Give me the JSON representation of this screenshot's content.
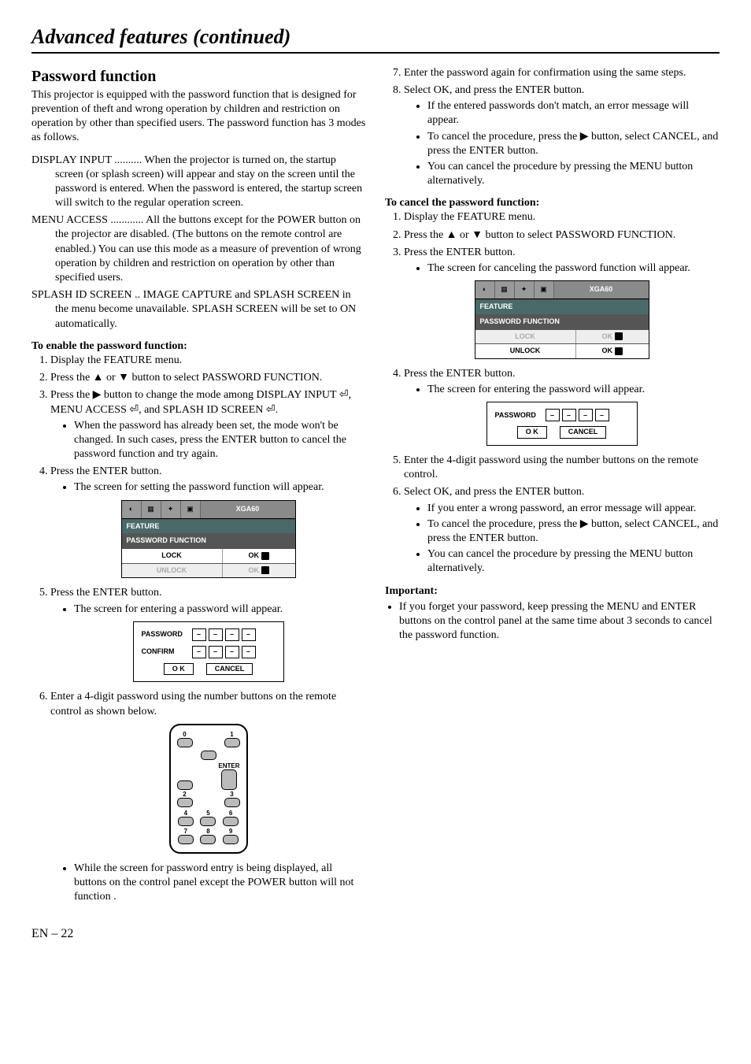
{
  "page_title": "Advanced features (continued)",
  "page_number": "EN – 22",
  "left": {
    "section_title": "Password function",
    "intro": "This projector is equipped with the password function that is designed for prevention of theft and wrong operation by children and restriction on operation by other than specified users. The password function has 3 modes as follows.",
    "modes": [
      "DISPLAY INPUT .......... When the projector is turned on, the startup screen (or splash screen) will appear and stay on the screen until the password is entered. When the password is entered, the startup screen will switch to the regular operation screen.",
      "MENU ACCESS ............ All the buttons except for the POWER button on the projector are disabled. (The buttons on the remote control are enabled.) You can use this mode as a measure of prevention of wrong operation by children and restriction on operation by other than specified users.",
      "SPLASH ID SCREEN .. IMAGE CAPTURE and SPLASH SCREEN in the menu become unavailable. SPLASH SCREEN will be set to ON automatically."
    ],
    "enable_head": "To enable the password function:",
    "steps_a": [
      "Display the FEATURE menu.",
      "Press the ▲ or ▼ button to select PASSWORD FUNCTION.",
      "Press the ▶ button to change the mode among DISPLAY INPUT ⏎, MENU ACCESS ⏎, and SPLASH ID SCREEN ⏎."
    ],
    "step3_bullet": "When the password has already been set, the mode won't be changed. In such cases, press the ENTER button to cancel the password function and try again.",
    "step4": "Press the ENTER button.",
    "step4_bullet": "The screen for setting the password function will appear.",
    "menu1": {
      "res": "XGA60",
      "feature": "FEATURE",
      "pwfunc": "PASSWORD FUNCTION",
      "lock": "LOCK",
      "unlock": "UNLOCK",
      "ok": "OK"
    },
    "step5": "Press the ENTER button.",
    "step5_bullet": "The screen for entering a password will appear.",
    "pw1": {
      "password": "PASSWORD",
      "confirm": "CONFIRM",
      "ok": "O K",
      "cancel": "CANCEL",
      "dash": "–"
    },
    "step6": "Enter a 4-digit password using the number buttons on the remote control as shown below.",
    "remote": {
      "enter": "ENTER",
      "n0": "0",
      "n1": "1",
      "n2": "2",
      "n3": "3",
      "n4": "4",
      "n5": "5",
      "n6": "6",
      "n7": "7",
      "n8": "8",
      "n9": "9"
    },
    "step6_bullet": "While the screen for password entry is being displayed, all buttons on the control panel except the POWER button will not function ."
  },
  "right": {
    "step7": "Enter the password again for confirmation using the same steps.",
    "step8": "Select OK, and press the ENTER button.",
    "step8_bullets": [
      "If the entered passwords don't match, an error message will appear.",
      "To cancel the procedure, press the ▶ button, select CANCEL, and press the ENTER button.",
      "You can cancel the procedure by pressing the MENU button alternatively."
    ],
    "cancel_head": "To cancel the password function:",
    "cancel_steps": [
      "Display the FEATURE menu.",
      "Press the ▲ or ▼ button to select PASSWORD FUNCTION.",
      "Press the ENTER button."
    ],
    "cancel_step3_bullet": "The screen for canceling the password function will appear.",
    "menu2": {
      "res": "XGA60",
      "feature": "FEATURE",
      "pwfunc": "PASSWORD FUNCTION",
      "lock": "LOCK",
      "unlock": "UNLOCK",
      "ok": "OK"
    },
    "step4b": "Press the ENTER button.",
    "step4b_bullet": "The screen for entering the password will appear.",
    "pw2": {
      "password": "PASSWORD",
      "ok": "O K",
      "cancel": "CANCEL",
      "dash": "–"
    },
    "step5b": "Enter the 4-digit password using the number buttons on the remote control.",
    "step6b": "Select OK, and press the ENTER button.",
    "step6b_bullets": [
      "If you enter a wrong password, an error message will appear.",
      "To cancel the procedure, press the ▶ button, select CANCEL, and press the ENTER button.",
      "You can cancel the procedure by pressing the MENU button alternatively."
    ],
    "important_head": "Important:",
    "important_bullet": "If you forget your password, keep pressing the MENU and ENTER buttons on the control panel at the same time about 3 seconds to cancel the password function."
  }
}
